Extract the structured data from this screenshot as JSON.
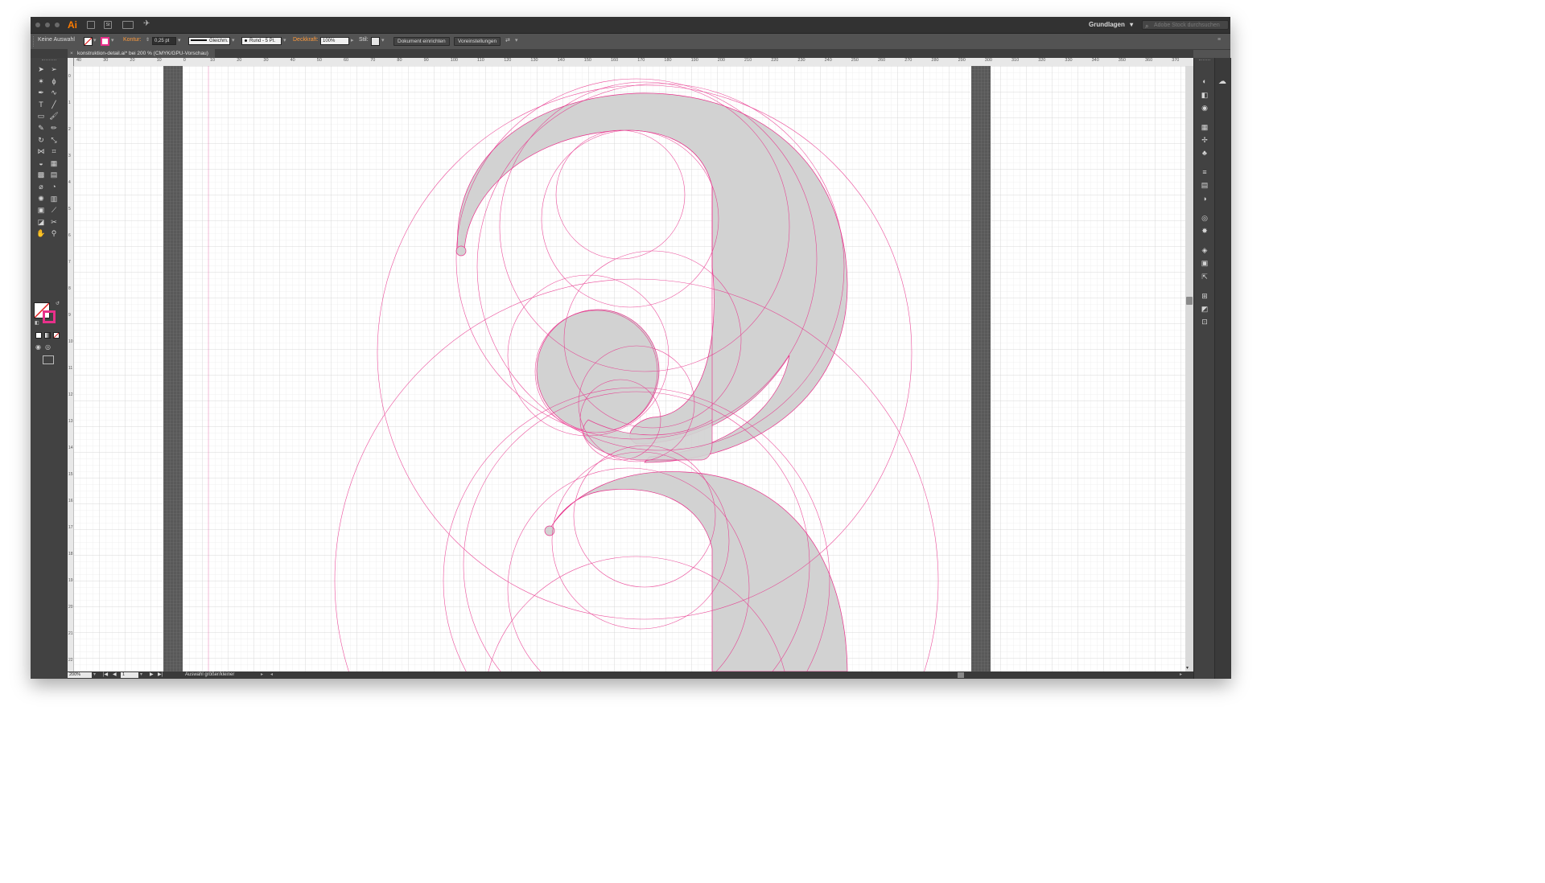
{
  "app": {
    "logo": "Ai",
    "workspace": "Grundlagen",
    "workspace_caret": "▾",
    "search_placeholder": "Adobe Stock durchsuchen",
    "doc_switch_label": "St"
  },
  "controlbar": {
    "selection": "Keine Auswahl",
    "stroke_label": "Kontur:",
    "stroke_value": "0,25 pt",
    "profile_value": "Gleichm.",
    "brush_value": "Rund - 5 Pt.",
    "opacity_label": "Deckkraft:",
    "opacity_value": "100%",
    "style_label": "Stil:",
    "doc_setup_button": "Dokument einrichten",
    "prefs_button": "Voreinstellungen",
    "stroke_color": "#e8308a"
  },
  "tab": {
    "close": "×",
    "title": "konstruktion-detail.ai* bei 200 % (CMYK/GPU-Vorschau)"
  },
  "ruler": {
    "h_ticks": [
      "40",
      "30",
      "20",
      "10",
      "0",
      "10",
      "20",
      "30",
      "40",
      "50",
      "60",
      "70",
      "80",
      "90",
      "100",
      "110",
      "120",
      "130",
      "140",
      "150",
      "160",
      "170",
      "180",
      "190",
      "200",
      "210",
      "220",
      "230",
      "240",
      "250",
      "260",
      "270",
      "280",
      "290",
      "300",
      "310",
      "320",
      "330",
      "340",
      "350",
      "360",
      "370"
    ],
    "v_ticks": [
      "0",
      "1",
      "2",
      "3",
      "4",
      "5",
      "6",
      "7",
      "8",
      "9",
      "10",
      "11",
      "12",
      "13",
      "14",
      "15",
      "16",
      "17",
      "18",
      "19",
      "20",
      "21",
      "22"
    ]
  },
  "status": {
    "zoom": "200%",
    "artboard": "1",
    "nav_first": "|◀",
    "nav_prev": "◀",
    "nav_next": "▶",
    "nav_last": "▶|",
    "info": "Auswahl größer/kleiner"
  },
  "colors": {
    "guide_pink": "#e8308a",
    "glyph_fill": "#d2d2d2",
    "ui_dark": "#535353"
  },
  "icons": {
    "left_tools": [
      "selection-icon",
      "direct-selection-icon",
      "magic-wand-icon",
      "lasso-icon",
      "pen-icon",
      "curvature-icon",
      "type-icon",
      "line-icon",
      "rectangle-icon",
      "paintbrush-icon",
      "shaper-icon",
      "pencil-icon",
      "rotate-icon",
      "scale-icon",
      "width-icon",
      "free-transform-icon",
      "shape-builder-icon",
      "perspective-icon",
      "mesh-icon",
      "gradient-icon",
      "eyedropper-icon",
      "blend-icon",
      "symbol-sprayer-icon",
      "column-graph-icon",
      "artboard-icon",
      "slice-icon",
      "eraser-icon",
      "scissors-icon",
      "hand-icon",
      "zoom-icon"
    ],
    "right_dock": [
      "color-icon",
      "color-guide-icon",
      "cc-libraries-icon",
      "swatches-icon",
      "brushes-icon",
      "symbols-icon",
      "stroke-icon",
      "gradient-panel-icon",
      "transparency-icon",
      "appearance-icon",
      "graphic-styles-icon",
      "layers-icon",
      "artboards-icon",
      "export-icon",
      "align-icon",
      "pathfinder-icon",
      "transform-icon"
    ]
  }
}
